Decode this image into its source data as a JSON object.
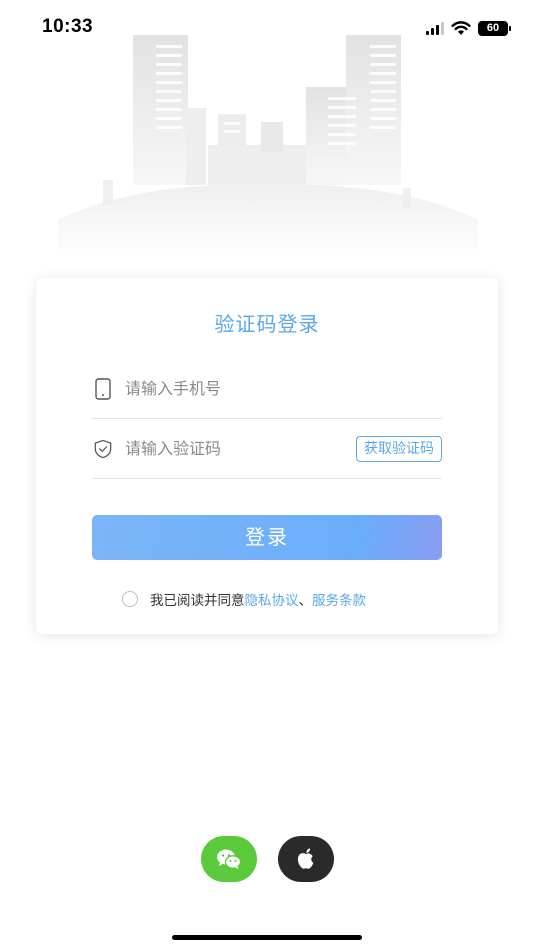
{
  "status_bar": {
    "time": "10:33",
    "battery": "60",
    "icons": [
      "cellular-signal-icon",
      "wifi-icon",
      "battery-icon"
    ]
  },
  "login": {
    "title": "验证码登录",
    "phone_placeholder": "请输入手机号",
    "code_placeholder": "请输入验证码",
    "get_code_label": "获取验证码",
    "submit_label": "登录",
    "agreement": {
      "prefix": "我已阅读并同意",
      "privacy_link": "隐私协议",
      "separator": "、",
      "terms_link": "服务条款",
      "checked": false
    }
  },
  "third_party": [
    {
      "name": "wechat",
      "icon": "wechat-icon",
      "color": "#5ac93a"
    },
    {
      "name": "apple",
      "icon": "apple-icon",
      "color": "#2a2a2a"
    }
  ],
  "colors": {
    "accent": "#5aa7ea",
    "button": "#6aaefa",
    "wechat": "#5ac93a",
    "apple": "#2a2a2a"
  }
}
